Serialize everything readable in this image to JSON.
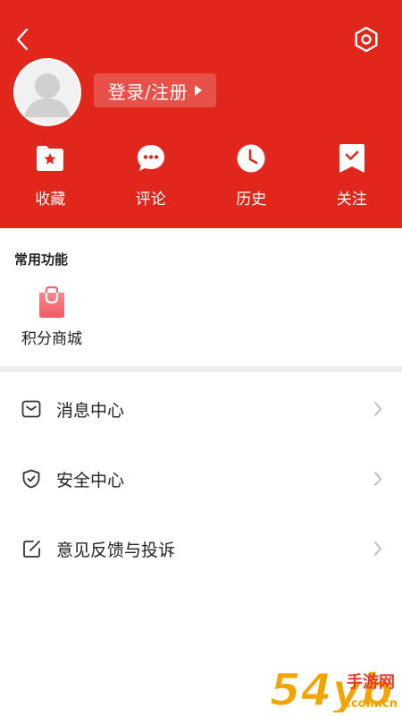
{
  "header": {
    "login_label": "登录/注册",
    "quick_actions": [
      {
        "label": "收藏",
        "icon": "folder-star-icon"
      },
      {
        "label": "评论",
        "icon": "chat-bubble-icon"
      },
      {
        "label": "历史",
        "icon": "clock-icon"
      },
      {
        "label": "关注",
        "icon": "bookmark-check-icon"
      }
    ]
  },
  "common": {
    "title": "常用功能",
    "items": [
      {
        "label": "积分商城",
        "icon": "shopping-bag-icon"
      }
    ]
  },
  "menu": {
    "items": [
      {
        "label": "消息中心",
        "icon": "message-icon"
      },
      {
        "label": "安全中心",
        "icon": "shield-icon"
      },
      {
        "label": "意见反馈与投诉",
        "icon": "edit-icon"
      }
    ]
  },
  "watermark": {
    "brand": "54yb",
    "name": "手游网",
    "domain": ".com.cn"
  },
  "colors": {
    "brand_red": "#e1261c",
    "text": "#222222",
    "divider": "#eeeeee",
    "chevron": "#bbbbbb",
    "bag_pink": "#f06a70"
  }
}
